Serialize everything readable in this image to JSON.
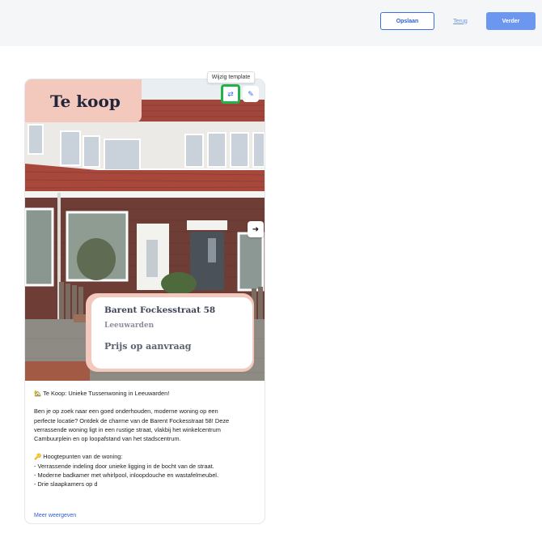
{
  "toolbar": {
    "save_label": "Opslaan",
    "back_label": "Terug",
    "next_label": "Verder"
  },
  "card": {
    "badge": "Te koop",
    "tooltip": "Wijzig template",
    "icons": {
      "swap": "swap-icon",
      "edit": "pencil-icon",
      "next": "arrow-right-icon"
    },
    "info": {
      "address": "Barent Fockesstraat 58",
      "city": "Leeuwarden",
      "price": "Prijs op aanvraag"
    },
    "description": [
      "🏡 Te Koop: Unieke Tussenwoning in Leeuwarden!",
      "",
      "Ben je op zoek naar een goed onderhouden, moderne woning op een",
      "perfecte locatie? Ontdek de charme van de Barent Fockesstraat 58! Deze",
      "verrassende woning ligt in een rustige straat, vlakbij het winkelcentrum",
      "Cambuurplein en op loopafstand van het stadscentrum.",
      "",
      "🔑 Hoogtepunten van de woning:",
      "- Verrassende indeling door unieke ligging in de bocht van de straat.",
      "- Moderne badkamer met whirlpool, inloopdouche en wastafelmeubel.",
      "- Drie slaapkamers op d"
    ],
    "more_label": "Meer weergeven"
  },
  "colors": {
    "accent": "#3a6fe6",
    "badge": "#f3c9bd",
    "highlight": "#22b24a"
  }
}
